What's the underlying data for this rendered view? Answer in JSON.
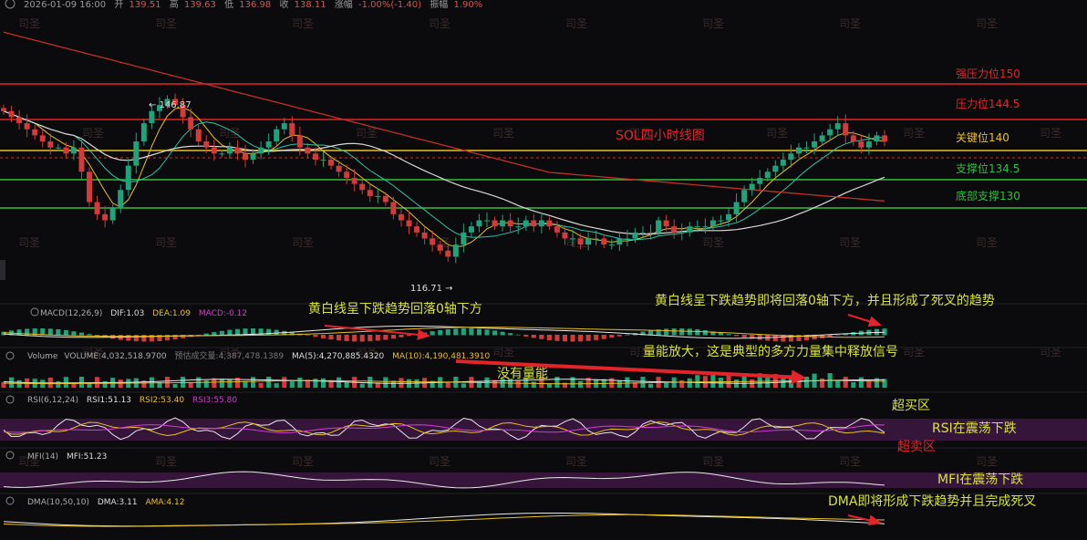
{
  "header": {
    "date": "2026-01-09 16:00",
    "open_label": "开",
    "open": "139.51",
    "high_label": "高",
    "high": "139.63",
    "low_label": "低",
    "low": "136.98",
    "close_label": "收",
    "close": "138.11",
    "change_label": "涨幅",
    "change": "-1.00%(-1.40)",
    "amp_label": "振幅",
    "amp": "1.90%"
  },
  "watermark": "司圣",
  "title": "SOL四小时线图",
  "levels": [
    {
      "label": "强压力位150",
      "value": 150,
      "color": "#e3242b"
    },
    {
      "label": "压力位144.5",
      "value": 144.5,
      "color": "#e3242b"
    },
    {
      "label": "关键位140",
      "value": 140,
      "color": "#e8c020"
    },
    {
      "label": "支撑位134.5",
      "value": 134.5,
      "color": "#2fbf3f"
    },
    {
      "label": "底部支撑130",
      "value": 130,
      "color": "#2fbf3f"
    }
  ],
  "extremes": {
    "high": "146.87",
    "low": "116.71"
  },
  "panels": {
    "macd": {
      "title": "MACD(12,26,9)",
      "dif": "DIF:1.03",
      "dea": "DEA:1.09",
      "macd": "MACD:-0.12",
      "note1": "黄白线呈下跌趋势回落0轴下方",
      "note2": "黄白线呈下跌趋势即将回落0轴下方，并且形成了死叉的趋势"
    },
    "volume": {
      "title": "Volume",
      "vol": "VOLUME:4,032,518.9700",
      "est": "预估成交量:4,387,478.1389",
      "ma5": "MA(5):4,270,885.4320",
      "ma10": "MA(10):4,190,481.3910",
      "note1": "没有量能",
      "note2": "量能放大，这是典型的多方力量集中释放信号"
    },
    "rsi": {
      "title": "RSI(6,12,24)",
      "rsi1": "RSI1:51.13",
      "rsi2": "RSI2:53.40",
      "rsi3": "RSI3:55.80",
      "overbought": "超买区",
      "oversold": "超卖区",
      "note": "RSI在震荡下跌"
    },
    "mfi": {
      "title": "MFI(14)",
      "value": "MFI:51.23",
      "note": "MFI在震荡下跌"
    },
    "dma": {
      "title": "DMA(10,50,10)",
      "dma": "DMA:3.11",
      "ama": "AMA:4.12",
      "note": "DMA即将形成下跌趋势并且完成死叉"
    }
  },
  "chart_data": {
    "type": "candlestick",
    "title": "SOL四小时线图",
    "ylim": [
      112,
      158
    ],
    "horizontal_levels": [
      150,
      144.5,
      140,
      134.5,
      130
    ],
    "close_series": [
      143,
      142,
      141,
      140,
      139,
      138,
      137,
      137,
      136,
      137,
      133,
      128,
      126,
      125,
      127,
      130,
      134,
      138,
      141,
      143,
      144,
      145,
      144,
      142,
      140,
      138,
      137,
      136,
      136,
      137,
      136,
      135,
      136,
      137,
      138,
      140,
      141,
      139,
      137,
      136,
      135,
      135,
      134,
      133,
      132,
      131,
      130,
      129,
      129,
      128,
      126,
      125,
      124,
      123,
      122,
      121,
      120,
      119,
      121,
      123,
      124,
      125,
      125,
      124,
      125,
      124,
      124,
      125,
      124,
      125,
      124,
      123,
      122,
      122,
      121,
      122,
      122,
      121,
      121,
      122,
      122,
      123,
      123,
      123,
      125,
      124,
      123,
      123,
      124,
      124,
      124,
      125,
      125,
      126,
      128,
      130,
      131,
      132,
      133,
      134,
      135,
      136,
      137,
      137,
      138,
      139,
      140,
      141,
      139,
      138,
      137,
      138,
      139,
      138
    ]
  }
}
